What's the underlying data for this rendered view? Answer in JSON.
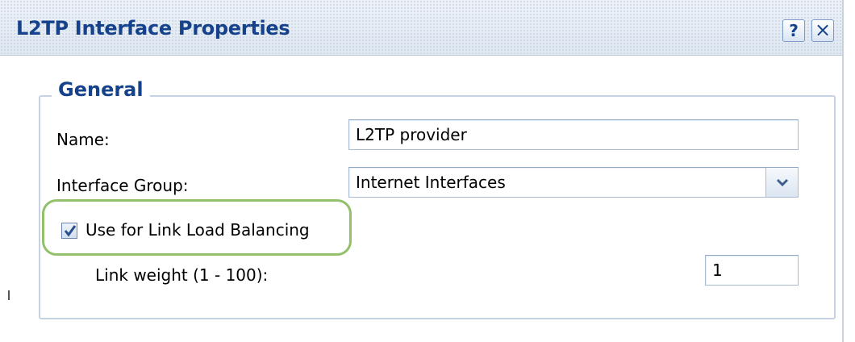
{
  "dialog": {
    "title": "L2TP Interface Properties",
    "help_label": "?",
    "close_label": "×"
  },
  "general": {
    "legend": "General",
    "name_label": "Name:",
    "name_value": "L2TP provider",
    "group_label": "Interface Group:",
    "group_value": "Internet Interfaces",
    "load_balancing_label": "Use for Link Load Balancing",
    "load_balancing_checked": true,
    "weight_label": "Link weight (1 - 100):",
    "weight_value": "1"
  },
  "colors": {
    "title_text": "#15428b",
    "highlight": "#93c06a",
    "border": "#a8bcd4"
  }
}
